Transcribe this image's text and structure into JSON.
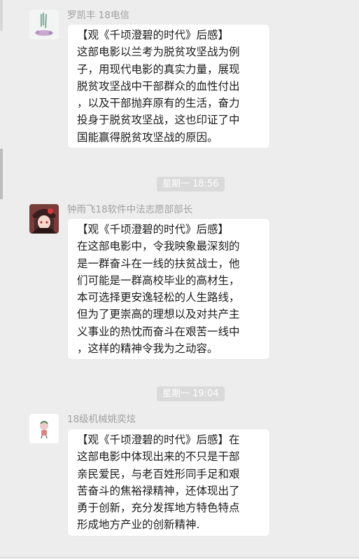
{
  "messages": [
    {
      "sender": "罗凯丰 18电信",
      "text": "【观《千顷澄碧的时代》后感】\n这部电影以兰考为脱贫攻坚战为例\n子，用现代电影的真实力量，展现\n脱贫攻坚战中干部群众的血性付出\n，以及干部抛弃原有的生活，奋力\n投身于脱贫攻坚战，这也印证了中\n国能赢得脱贫攻坚战的原因。"
    },
    {
      "time": "星期一 18:56",
      "sender": "钟雨飞18软件中法志愿部部长",
      "text": "【观《千顷澄碧的时代》后感】\n在这部电影中，令我映象最深刻的\n是一群奋斗在一线的扶贫战士，他\n们可能是一群高校毕业的高材生，\n本可选择更安逸轻松的人生路线，\n但为了更崇高的理想以及对共产主\n义事业的热忱而奋斗在艰苦一线中\n，这样的精神令我为之动容。"
    },
    {
      "time": "星期一 19:04",
      "sender": "18级机械姚奕炫",
      "text": "【观《千顷澄碧的时代》后感】在\n这部电影中体现出来的不只是干部\n亲民爱民，与老百姓形同手足和艰\n苦奋斗的焦裕禄精神，还体现出了\n勇于创新，充分发挥地方特色特点\n形成地方产业的创新精神."
    }
  ]
}
